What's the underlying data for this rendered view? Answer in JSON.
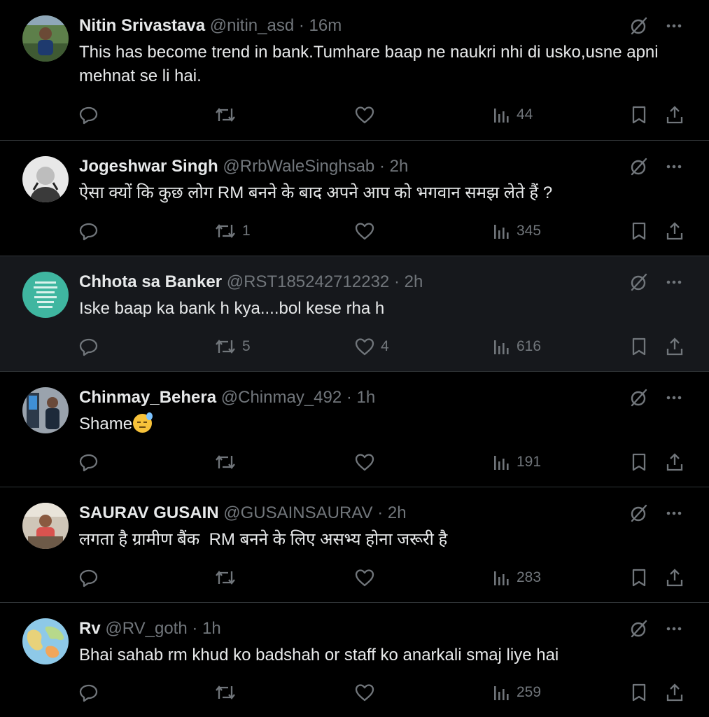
{
  "tweets": [
    {
      "name": "Nitin Srivastava",
      "handle": "@nitin_asd",
      "time": "16m",
      "text": "This has become trend in bank.Tumhare baap ne naukri nhi di usko,usne apni mehnat se li hai.",
      "replies": "",
      "retweets": "",
      "likes": "",
      "views": "44"
    },
    {
      "name": "Jogeshwar Singh",
      "handle": "@RrbWaleSinghsab",
      "time": "2h",
      "text": "ऐसा क्यों कि कुछ लोग RM बनने के बाद अपने आप को भगवान समझ लेते हैं ?",
      "replies": "",
      "retweets": "1",
      "likes": "",
      "views": "345"
    },
    {
      "name": "Chhota sa Banker",
      "handle": "@RST185242712232",
      "time": "2h",
      "text": "Iske baap ka bank h kya....bol kese rha h",
      "replies": "",
      "retweets": "5",
      "likes": "4",
      "views": "616"
    },
    {
      "name": "Chinmay_Behera",
      "handle": "@Chinmay_492",
      "time": "1h",
      "text": "Shame",
      "emoji": "downcast-face-with-sweat",
      "replies": "",
      "retweets": "",
      "likes": "",
      "views": "191"
    },
    {
      "name": "SAURAV GUSAIN",
      "handle": "@GUSAINSAURAV",
      "time": "2h",
      "text": "लगता है ग्रामीण बैंक  RM बनने के लिए असभ्य होना जरूरी है",
      "replies": "",
      "retweets": "",
      "likes": "",
      "views": "283"
    },
    {
      "name": "Rv",
      "handle": "@RV_goth",
      "time": "1h",
      "text": "Bhai sahab rm khud ko badshah or staff ko anarkali smaj liye hai",
      "replies": "",
      "retweets": "",
      "likes": "",
      "views": "259"
    }
  ],
  "separator": " · ",
  "icons": [
    "grok-icon",
    "more-icon",
    "reply-icon",
    "retweet-icon",
    "like-icon",
    "views-icon",
    "bookmark-icon",
    "share-icon"
  ],
  "colors": {
    "background": "#000000",
    "highlight": "#16181c",
    "text": "#e7e9ea",
    "muted": "#71767b",
    "border": "#2f3336"
  }
}
